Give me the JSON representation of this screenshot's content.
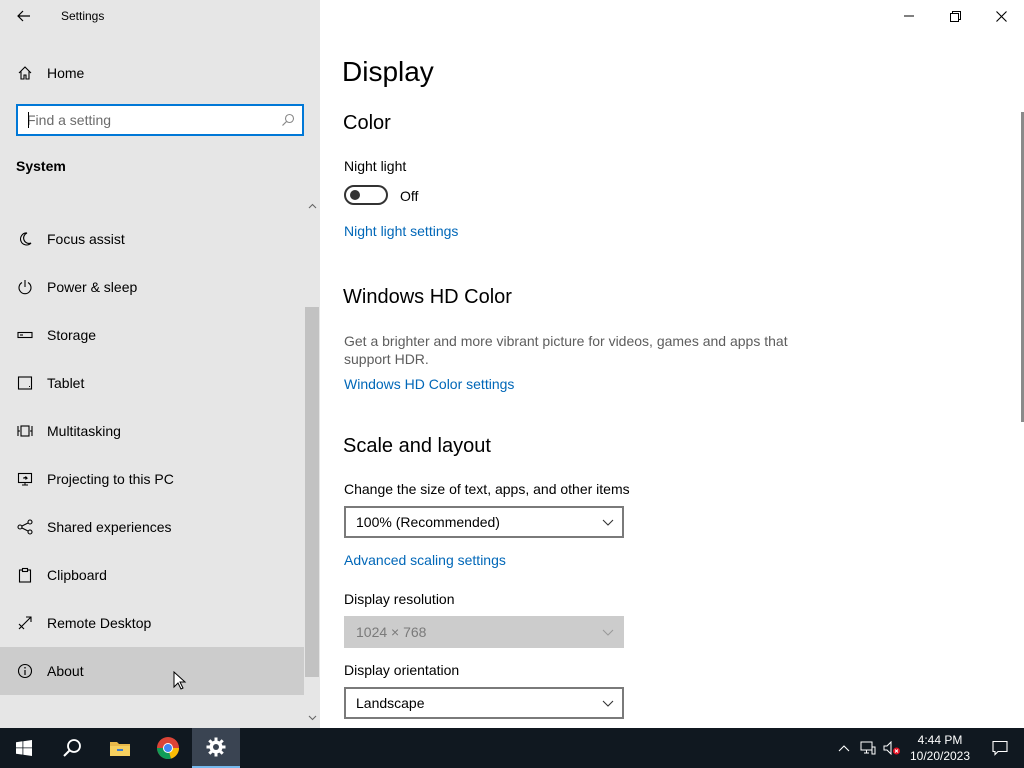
{
  "window": {
    "title": "Settings"
  },
  "sidebar": {
    "home_label": "Home",
    "search_placeholder": "Find a setting",
    "section": "System",
    "items": [
      {
        "label": "Focus assist",
        "icon": "moon-icon"
      },
      {
        "label": "Power & sleep",
        "icon": "power-icon"
      },
      {
        "label": "Storage",
        "icon": "storage-icon"
      },
      {
        "label": "Tablet",
        "icon": "tablet-icon"
      },
      {
        "label": "Multitasking",
        "icon": "multitasking-icon"
      },
      {
        "label": "Projecting to this PC",
        "icon": "projecting-icon"
      },
      {
        "label": "Shared experiences",
        "icon": "shared-icon"
      },
      {
        "label": "Clipboard",
        "icon": "clipboard-icon"
      },
      {
        "label": "Remote Desktop",
        "icon": "remote-desktop-icon"
      },
      {
        "label": "About",
        "icon": "info-icon",
        "hovered": true
      }
    ]
  },
  "main": {
    "title": "Display",
    "color": {
      "heading": "Color",
      "night_light_label": "Night light",
      "night_light_state": "Off",
      "night_light_link": "Night light settings"
    },
    "hd_color": {
      "heading": "Windows HD Color",
      "description": "Get a brighter and more vibrant picture for videos, games and apps that support HDR.",
      "link": "Windows HD Color settings"
    },
    "scale": {
      "heading": "Scale and layout",
      "size_label": "Change the size of text, apps, and other items",
      "size_value": "100% (Recommended)",
      "advanced_link": "Advanced scaling settings",
      "resolution_label": "Display resolution",
      "resolution_value": "1024 × 768",
      "orientation_label": "Display orientation",
      "orientation_value": "Landscape"
    }
  },
  "taskbar": {
    "time": "4:44 PM",
    "date": "10/20/2023"
  },
  "colors": {
    "accent": "#0078d7",
    "link": "#0067b8",
    "sidebar_bg": "#e6e6e6",
    "taskbar_bg": "#101820"
  }
}
